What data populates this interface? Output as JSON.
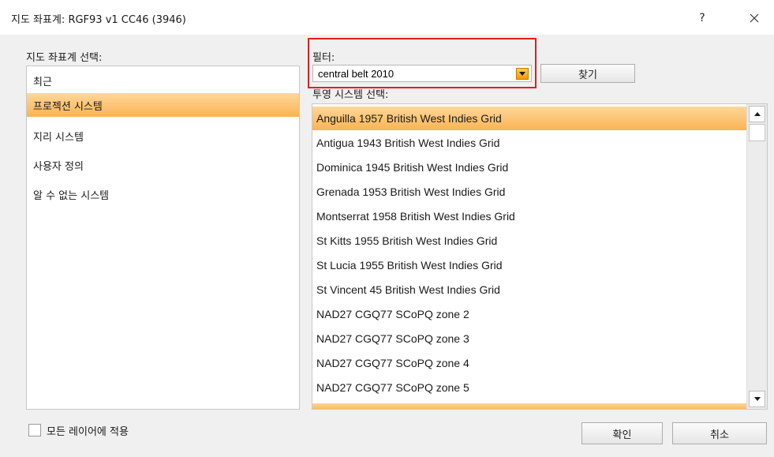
{
  "window": {
    "title": "지도 좌표계: RGF93 v1 CC46 (3946)",
    "help_label": "?",
    "close_icon": "close-icon"
  },
  "left_panel": {
    "label": "지도 좌표계 선택:",
    "items": [
      {
        "label": "최근",
        "selected": false
      },
      {
        "label": "프로젝션 시스템",
        "selected": true
      },
      {
        "label": "지리 시스템",
        "selected": false
      },
      {
        "label": "사용자 정의",
        "selected": false
      },
      {
        "label": "알 수 없는 시스템",
        "selected": false
      }
    ]
  },
  "filter": {
    "label": "필터:",
    "value": "central belt 2010",
    "dropdown_icon": "chevron-down-icon",
    "find_label": "찾기"
  },
  "projection": {
    "label": "투영 시스템 선택:",
    "items": [
      {
        "label": "Anguilla 1957 British West Indies Grid",
        "selected": true
      },
      {
        "label": "Antigua 1943 British West Indies Grid",
        "selected": false
      },
      {
        "label": "Dominica 1945 British West Indies Grid",
        "selected": false
      },
      {
        "label": "Grenada 1953 British West Indies Grid",
        "selected": false
      },
      {
        "label": "Montserrat 1958 British West Indies Grid",
        "selected": false
      },
      {
        "label": "St Kitts 1955 British West Indies Grid",
        "selected": false
      },
      {
        "label": "St Lucia 1955 British West Indies Grid",
        "selected": false
      },
      {
        "label": "St Vincent 45 British West Indies Grid",
        "selected": false
      },
      {
        "label": "NAD27 CGQ77 SCoPQ zone 2",
        "selected": false
      },
      {
        "label": "NAD27 CGQ77 SCoPQ zone 3",
        "selected": false
      },
      {
        "label": "NAD27 CGQ77 SCoPQ zone 4",
        "selected": false
      },
      {
        "label": "NAD27 CGQ77 SCoPQ zone 5",
        "selected": false
      }
    ]
  },
  "footer": {
    "apply_all_label": "모든 레이어에 적용",
    "apply_all_checked": false,
    "ok_label": "확인",
    "cancel_label": "취소"
  },
  "colors": {
    "selection": "#f9b452",
    "highlight_box": "#e0201e",
    "dropdown_button": "#f59a00"
  }
}
